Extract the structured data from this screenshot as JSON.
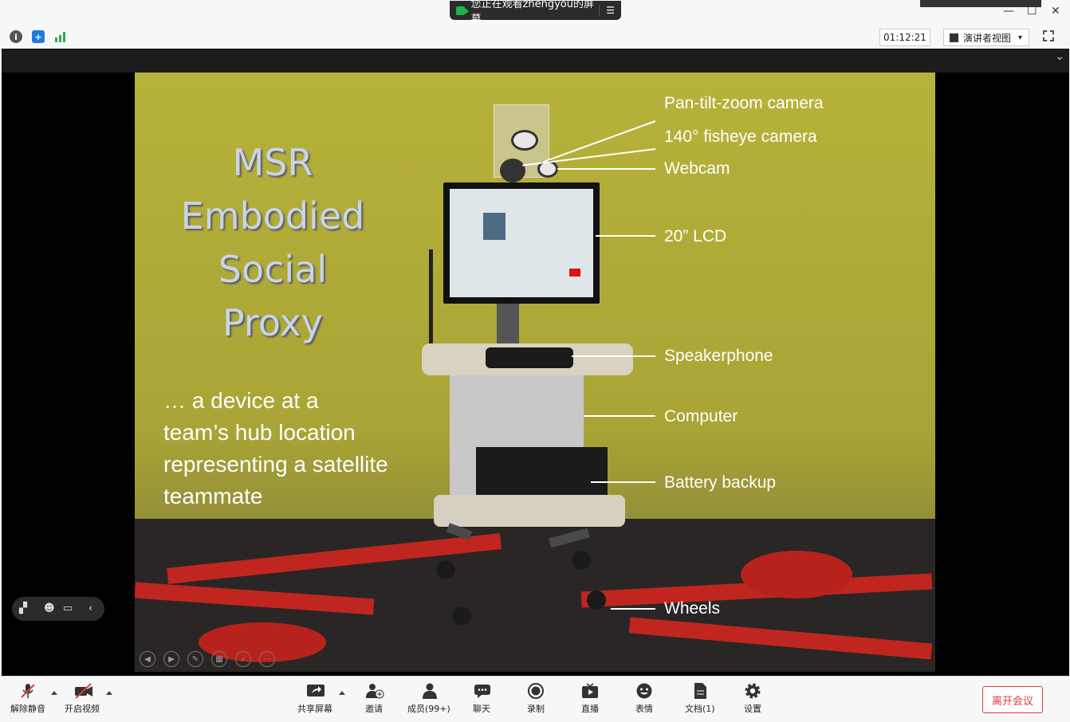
{
  "window": {
    "share_banner": "您正在观看zhengyou的屏幕",
    "minimize": "—",
    "maximize": "☐",
    "close": "✕"
  },
  "toolbar": {
    "timer": "01:12:21",
    "view_mode": "演讲者视图",
    "view_caret": "▾"
  },
  "slide": {
    "title_lines": [
      "MSR",
      "Embodied",
      "Social",
      "Proxy"
    ],
    "body_lines": [
      "… a device at a",
      "team’s hub location",
      "representing a satellite",
      "teammate"
    ],
    "labels": [
      "Pan-tilt-zoom camera",
      "140° fisheye camera",
      "Webcam",
      "20” LCD",
      "Speakerphone",
      "Computer",
      "Battery backup",
      "Wheels"
    ]
  },
  "bottom": {
    "unmute": "解除静音",
    "start_video": "开启视频",
    "share_screen": "共享屏幕",
    "invite": "邀请",
    "members": "成员(99+)",
    "chat": "聊天",
    "record": "录制",
    "live": "直播",
    "reactions": "表情",
    "docs": "文档(1)",
    "settings": "设置",
    "leave": "离开会议"
  },
  "colors": {
    "leave_red": "#e03c3c",
    "shield_blue": "#1e7be0",
    "signal_green": "#22b14c",
    "slide_bg": "#b7b23a"
  }
}
